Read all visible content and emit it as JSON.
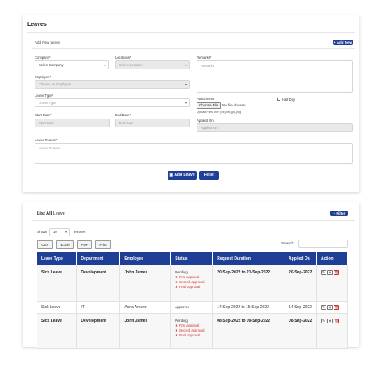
{
  "leaves": {
    "title": "Leaves",
    "add_new_title": "Add New Leave",
    "add_new_button": "+ Add New",
    "company": {
      "label": "Company*",
      "value": "Select Company"
    },
    "locations": {
      "label": "Locations*",
      "placeholder": "Select Location"
    },
    "remarks": {
      "label": "Remarks*",
      "placeholder": "Remarks"
    },
    "employee": {
      "label": "Employee*",
      "placeholder": "Choose an Employee"
    },
    "leave_type": {
      "label": "Leave Type*",
      "placeholder": "Leave Type"
    },
    "attachment": {
      "label": "Attachment",
      "button": "Choose File",
      "file_text": "No file chosen",
      "hint": "Upload Files only: pdf,jpeg,jpg,png"
    },
    "half_day": {
      "label": "Half Day"
    },
    "start_date": {
      "label": "Start Date*",
      "placeholder": "Start Date"
    },
    "end_date": {
      "label": "End Date*",
      "placeholder": "End Date"
    },
    "applied_on": {
      "label": "Applied On",
      "placeholder": "Applied On"
    },
    "leave_reason": {
      "label": "Leave Reason*",
      "placeholder": "Leave Reason"
    },
    "add_leave_button": "Add Leave",
    "reset_button": "Reset"
  },
  "list": {
    "title_bold": "List All",
    "title_rest": "Leave",
    "filter_button": "+ Filter",
    "show_label": "Show",
    "entries_value": "10",
    "entries_label": "entries",
    "export_buttons": [
      "CSV",
      "Excel",
      "PDF",
      "Print"
    ],
    "search_label": "Search:",
    "columns": [
      "Leave Type",
      "Department",
      "Employee",
      "Status",
      "Request Duration",
      "Applied On",
      "Action"
    ],
    "rows": [
      {
        "leave_type": "Sick Leave",
        "department": "Development",
        "employee": "John James",
        "status": "Pending",
        "approvals": [
          "✖ First approval",
          "✖ Second approval",
          "✖ Final approval"
        ],
        "duration": "20-Sep-2022 to 21-Sep-2022",
        "applied_on": "20-Sep-2022"
      },
      {
        "leave_type": "Sick Leave",
        "department": "IT",
        "employee": "Asna Ameer",
        "status": "Approved",
        "approvals": [],
        "duration": "14-Sep-2022 to 15-Sep-2022",
        "applied_on": "14-Sep-2022"
      },
      {
        "leave_type": "Sick Leave",
        "department": "Development",
        "employee": "John James",
        "status": "Pending",
        "approvals": [
          "✖ First approval",
          "✖ Second approval",
          "✖ Final approval"
        ],
        "duration": "08-Sep-2022 to 09-Sep-2022",
        "applied_on": "08-Sep-2022"
      }
    ]
  },
  "colors": {
    "primary": "#1f3f96",
    "danger": "#d0312d"
  }
}
